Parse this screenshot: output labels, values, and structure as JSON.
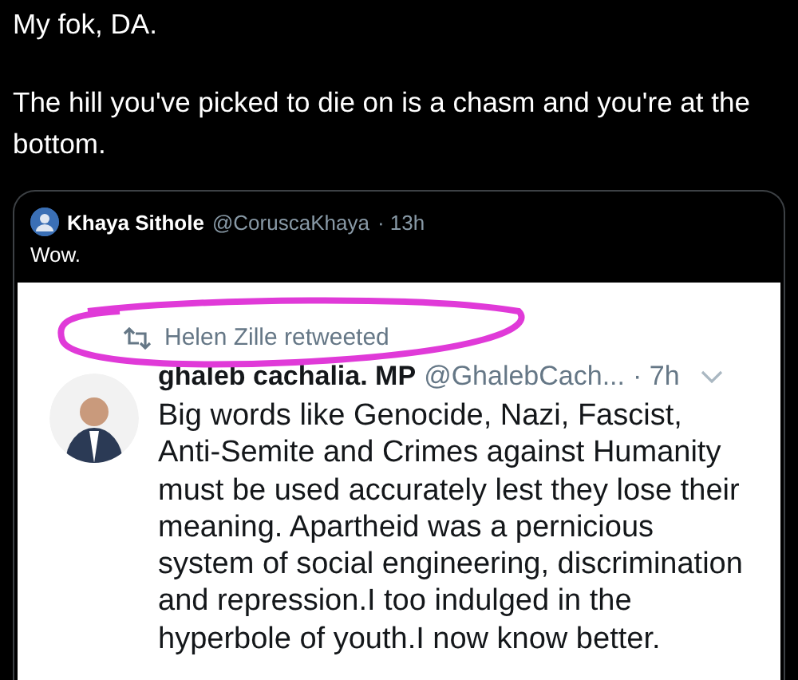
{
  "tweet": {
    "paragraphs": [
      "My fok, DA.",
      "The hill you've picked to die on is a chasm and you're at the  bottom."
    ]
  },
  "quoted_tweet": {
    "name": "Khaya Sithole",
    "handle": "@CoruscaKhaya",
    "time": "· 13h",
    "text": "Wow.",
    "screenshot": {
      "retweeted_by": "Helen Zille retweeted",
      "name": "ghaleb cachalia. MP",
      "handle": "@GhalebCach...",
      "time": "· 7h",
      "text": "Big words like Genocide, Nazi, Fascist, Anti-Semite and Crimes against Humanity must be used accurately lest they lose their meaning. Apartheid was a pernicious system of social engineering, discrimination and repression.I too indulged in the hyperbole of youth.I now know better."
    }
  }
}
